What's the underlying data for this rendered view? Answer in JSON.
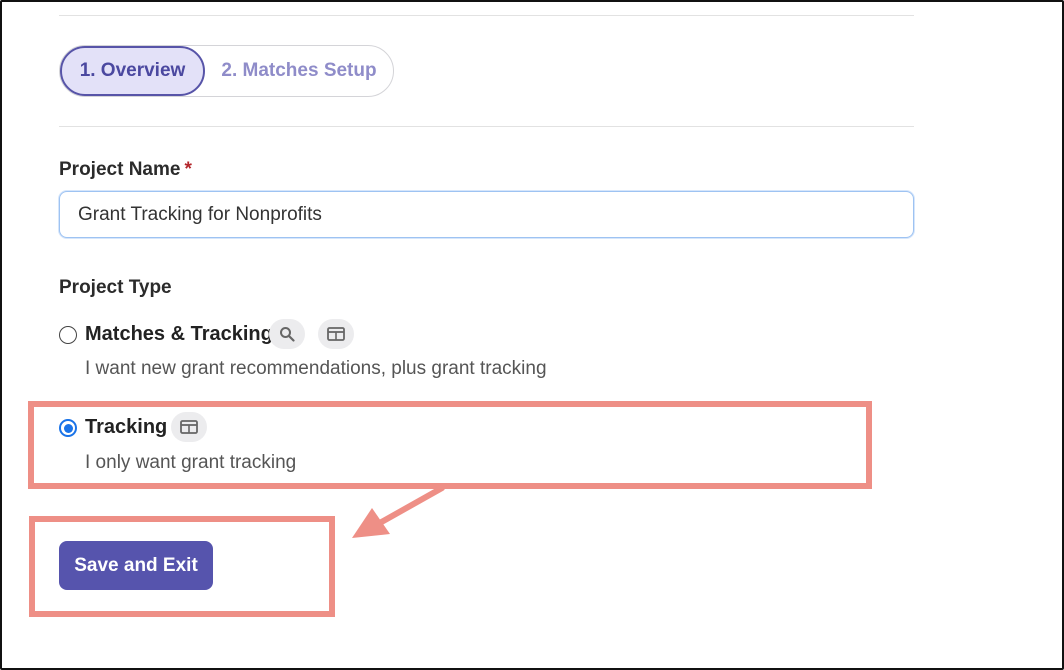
{
  "stepper": {
    "steps": [
      {
        "label": "1. Overview",
        "active": true
      },
      {
        "label": "2. Matches Setup",
        "active": false
      }
    ]
  },
  "project_name": {
    "label": "Project Name",
    "required_mark": "*",
    "value": "Grant Tracking for Nonprofits"
  },
  "project_type": {
    "label": "Project Type",
    "options": [
      {
        "title": "Matches & Tracking",
        "description": "I want new grant recommendations, plus grant tracking",
        "selected": false,
        "icons": [
          "search-icon",
          "table-icon"
        ]
      },
      {
        "title": "Tracking",
        "description": "I only want grant tracking",
        "selected": true,
        "icons": [
          "table-icon"
        ]
      }
    ]
  },
  "actions": {
    "save_exit_label": "Save and Exit"
  },
  "colors": {
    "accent": "#5654ad",
    "callout": "#ee8f86",
    "radio_selected": "#1a73e8",
    "required": "#b3262b"
  }
}
